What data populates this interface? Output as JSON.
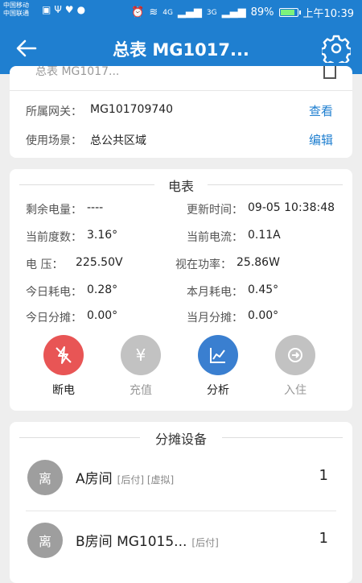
{
  "status_bar": {
    "carrier_1": "中国移动",
    "carrier_2": "中国联通",
    "signal_1": "4G",
    "signal_2": "3G",
    "battery": "89%",
    "time": "上午10:39"
  },
  "app_bar": {
    "title": "总表 MG1017..."
  },
  "gateway_card": {
    "clipped_text": "总表 MG1017...",
    "gateway_label": "所属网关：",
    "gateway_value": "MG101709740",
    "view_link": "查看",
    "scene_label": "使用场景：",
    "scene_value": "总公共区域",
    "edit_link": "编辑"
  },
  "meter_card": {
    "title": "电表",
    "fields": [
      {
        "label": "剩余电量：",
        "value": "----"
      },
      {
        "label": "更新时间：",
        "value": "09-05 10:38:48"
      },
      {
        "label": "当前度数：",
        "value": "3.16°"
      },
      {
        "label": "当前电流：",
        "value": "0.11A"
      },
      {
        "label": "电 压：",
        "value": "225.50V"
      },
      {
        "label": "视在功率：",
        "value": "25.86W"
      },
      {
        "label": "今日耗电：",
        "value": "0.28°"
      },
      {
        "label": "本月耗电：",
        "value": "0.45°"
      },
      {
        "label": "今日分摊：",
        "value": "0.00°"
      },
      {
        "label": "当月分摊：",
        "value": "0.00°"
      }
    ],
    "actions": [
      {
        "label": "断电",
        "icon": "power-off-icon",
        "color": "#e85555",
        "enabled": true
      },
      {
        "label": "充值",
        "icon": "yen-icon",
        "color": "#c2c2c2",
        "enabled": false
      },
      {
        "label": "分析",
        "icon": "chart-icon",
        "color": "#3a7fd0",
        "enabled": true
      },
      {
        "label": "入住",
        "icon": "check-in-icon",
        "color": "#c2c2c2",
        "enabled": false
      }
    ]
  },
  "devices_card": {
    "title": "分摊设备",
    "rooms": [
      {
        "avatar": "离",
        "name": "A房间",
        "tags": "[后付] [虚拟]",
        "count": "1"
      },
      {
        "avatar": "离",
        "name": "B房间 MG1015...",
        "tags": "[后付]",
        "count": "1"
      }
    ]
  },
  "colors": {
    "primary": "#1f7fd0",
    "danger": "#e85555",
    "disabled": "#c2c2c2"
  }
}
